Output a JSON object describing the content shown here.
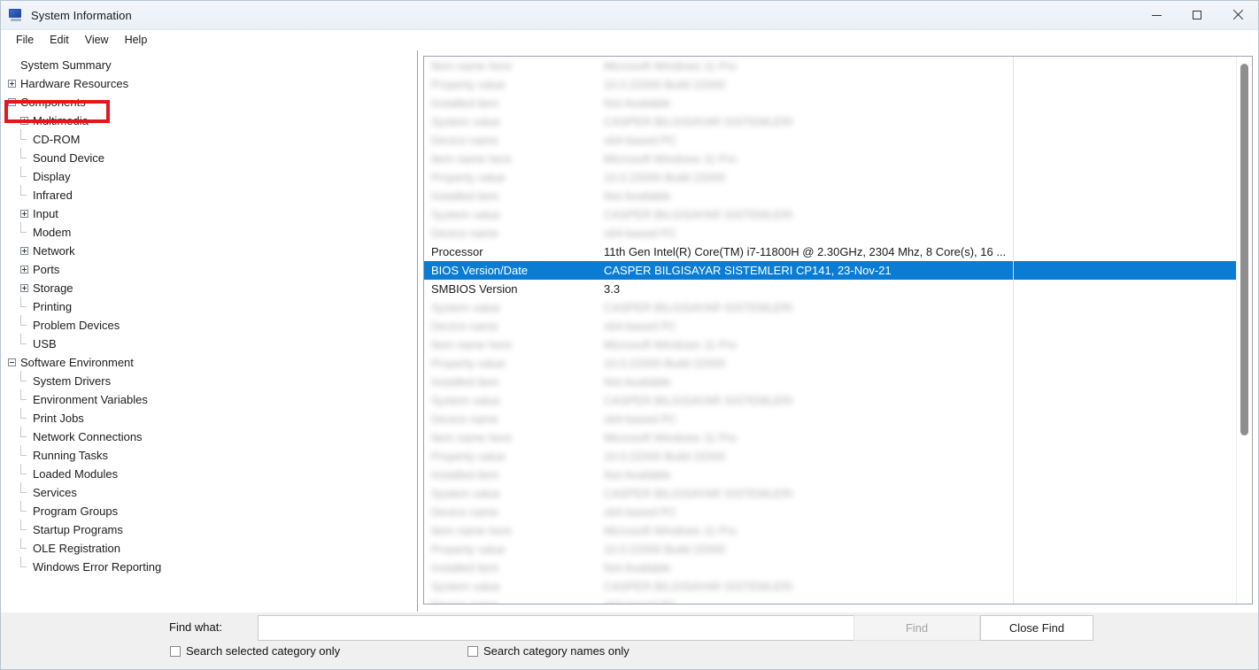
{
  "window": {
    "title": "System Information",
    "icon": "system-information-icon",
    "controls": {
      "minimize": "minimize-icon",
      "maximize": "maximize-icon",
      "close": "close-icon"
    }
  },
  "menubar": {
    "items": [
      {
        "label": "File"
      },
      {
        "label": "Edit"
      },
      {
        "label": "View"
      },
      {
        "label": "Help"
      }
    ]
  },
  "tree": {
    "highlighted_item": "System Summary",
    "highlight_color": "#e8161b",
    "items": [
      {
        "label": "System Summary",
        "depth": 0,
        "twisty": "none"
      },
      {
        "label": "Hardware Resources",
        "depth": 0,
        "twisty": "plus"
      },
      {
        "label": "Components",
        "depth": 0,
        "twisty": "minus"
      },
      {
        "label": "Multimedia",
        "depth": 1,
        "twisty": "plus"
      },
      {
        "label": "CD-ROM",
        "depth": 1,
        "twisty": "leaf"
      },
      {
        "label": "Sound Device",
        "depth": 1,
        "twisty": "leaf"
      },
      {
        "label": "Display",
        "depth": 1,
        "twisty": "leaf"
      },
      {
        "label": "Infrared",
        "depth": 1,
        "twisty": "leaf"
      },
      {
        "label": "Input",
        "depth": 1,
        "twisty": "plus"
      },
      {
        "label": "Modem",
        "depth": 1,
        "twisty": "leaf"
      },
      {
        "label": "Network",
        "depth": 1,
        "twisty": "plus"
      },
      {
        "label": "Ports",
        "depth": 1,
        "twisty": "plus"
      },
      {
        "label": "Storage",
        "depth": 1,
        "twisty": "plus"
      },
      {
        "label": "Printing",
        "depth": 1,
        "twisty": "leaf"
      },
      {
        "label": "Problem Devices",
        "depth": 1,
        "twisty": "leaf"
      },
      {
        "label": "USB",
        "depth": 1,
        "twisty": "leaf"
      },
      {
        "label": "Software Environment",
        "depth": 0,
        "twisty": "minus"
      },
      {
        "label": "System Drivers",
        "depth": 1,
        "twisty": "leaf"
      },
      {
        "label": "Environment Variables",
        "depth": 1,
        "twisty": "leaf"
      },
      {
        "label": "Print Jobs",
        "depth": 1,
        "twisty": "leaf"
      },
      {
        "label": "Network Connections",
        "depth": 1,
        "twisty": "leaf"
      },
      {
        "label": "Running Tasks",
        "depth": 1,
        "twisty": "leaf"
      },
      {
        "label": "Loaded Modules",
        "depth": 1,
        "twisty": "leaf"
      },
      {
        "label": "Services",
        "depth": 1,
        "twisty": "leaf"
      },
      {
        "label": "Program Groups",
        "depth": 1,
        "twisty": "leaf"
      },
      {
        "label": "Startup Programs",
        "depth": 1,
        "twisty": "leaf"
      },
      {
        "label": "OLE Registration",
        "depth": 1,
        "twisty": "leaf"
      },
      {
        "label": "Windows Error Reporting",
        "depth": 1,
        "twisty": "leaf"
      }
    ]
  },
  "details": {
    "selection_color": "#0a7cd3",
    "rows": [
      {
        "key": "",
        "value": "",
        "state": "blurred"
      },
      {
        "key": "",
        "value": "",
        "state": "blurred"
      },
      {
        "key": "",
        "value": "",
        "state": "blurred"
      },
      {
        "key": "",
        "value": "",
        "state": "blurred"
      },
      {
        "key": "",
        "value": "",
        "state": "blurred"
      },
      {
        "key": "",
        "value": "",
        "state": "blurred"
      },
      {
        "key": "",
        "value": "",
        "state": "blurred"
      },
      {
        "key": "",
        "value": "",
        "state": "blurred"
      },
      {
        "key": "",
        "value": "",
        "state": "blurred"
      },
      {
        "key": "",
        "value": "",
        "state": "blurred"
      },
      {
        "key": "Processor",
        "value": "11th Gen Intel(R) Core(TM) i7-11800H @ 2.30GHz, 2304 Mhz, 8 Core(s), 16 ...",
        "state": "normal"
      },
      {
        "key": "BIOS Version/Date",
        "value": "CASPER BILGISAYAR SISTEMLERI CP141, 23-Nov-21",
        "state": "selected"
      },
      {
        "key": "SMBIOS Version",
        "value": "3.3",
        "state": "normal"
      },
      {
        "key": "",
        "value": "",
        "state": "blurred"
      },
      {
        "key": "",
        "value": "",
        "state": "blurred"
      },
      {
        "key": "",
        "value": "",
        "state": "blurred"
      },
      {
        "key": "",
        "value": "",
        "state": "blurred"
      },
      {
        "key": "",
        "value": "",
        "state": "blurred"
      },
      {
        "key": "",
        "value": "",
        "state": "blurred"
      },
      {
        "key": "",
        "value": "",
        "state": "blurred"
      },
      {
        "key": "",
        "value": "",
        "state": "blurred"
      },
      {
        "key": "",
        "value": "",
        "state": "blurred"
      },
      {
        "key": "",
        "value": "",
        "state": "blurred"
      },
      {
        "key": "",
        "value": "",
        "state": "blurred"
      },
      {
        "key": "",
        "value": "",
        "state": "blurred"
      },
      {
        "key": "",
        "value": "",
        "state": "blurred"
      },
      {
        "key": "",
        "value": "",
        "state": "blurred"
      },
      {
        "key": "",
        "value": "",
        "state": "blurred"
      },
      {
        "key": "",
        "value": "",
        "state": "blurred"
      },
      {
        "key": "",
        "value": "",
        "state": "blurred"
      }
    ]
  },
  "findbar": {
    "label": "Find what:",
    "input_value": "",
    "input_placeholder": "",
    "find_button": "Find",
    "close_find_button": "Close Find",
    "checkbox_selected_category": "Search selected category only",
    "checkbox_category_names": "Search category names only",
    "checkbox_selected_category_checked": false,
    "checkbox_category_names_checked": false
  }
}
